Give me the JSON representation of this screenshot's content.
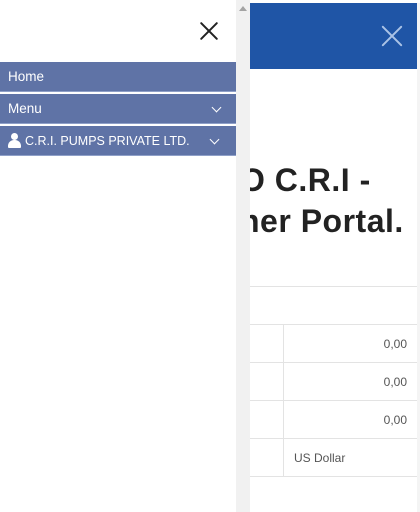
{
  "background": {
    "title_line1": "O C.R.I -",
    "title_line2": "ner Portal.",
    "table": {
      "rows": [
        {
          "value": "0,00"
        },
        {
          "value": "0,00"
        },
        {
          "value": "0,00"
        }
      ],
      "currency": "US Dollar"
    }
  },
  "drawer": {
    "items": [
      {
        "label": "Home"
      },
      {
        "label": "Menu"
      },
      {
        "label": "C.R.I. PUMPS PRIVATE LTD."
      }
    ]
  },
  "colors": {
    "header_blue": "#1f55a6",
    "nav_bg": "#5f73a6"
  },
  "icons": {
    "drawer_close": "close-icon",
    "header_close": "close-icon",
    "chevron": "chevron-down-icon",
    "user": "user-icon"
  }
}
